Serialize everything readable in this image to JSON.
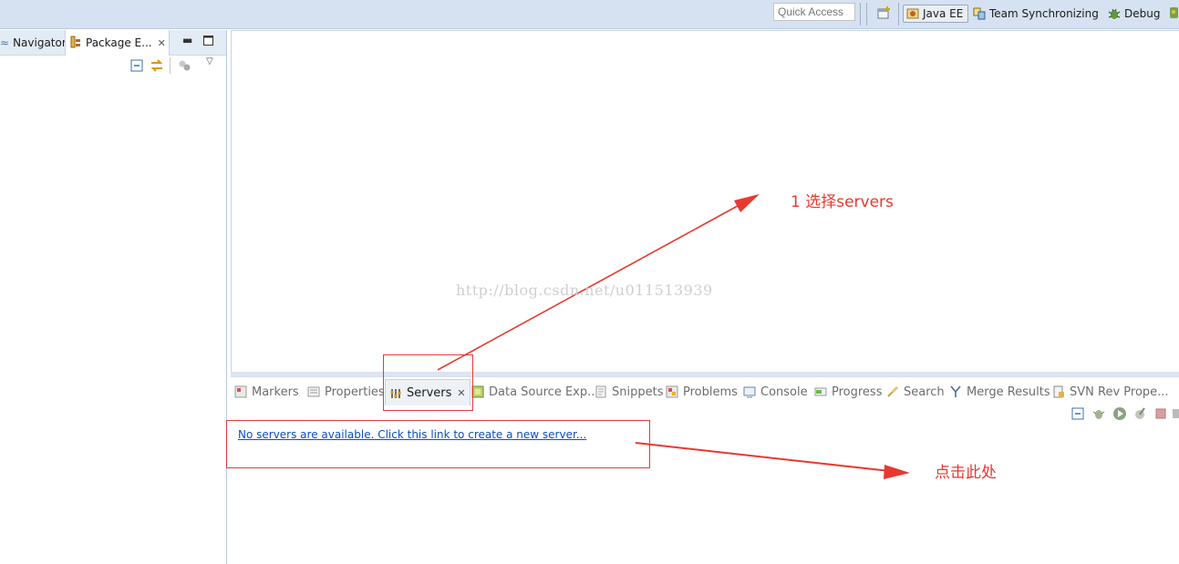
{
  "toolbar": {
    "quick_access_placeholder": "Quick Access",
    "perspectives": [
      {
        "label": "Java EE",
        "icon": "java-ee-perspective-icon",
        "active": true
      },
      {
        "label": "Team Synchronizing",
        "icon": "team-sync-icon"
      },
      {
        "label": "Debug",
        "icon": "bug-icon"
      }
    ]
  },
  "left_view": {
    "tabs": [
      {
        "label": "Navigator"
      },
      {
        "label": "Package E...",
        "active": true
      }
    ]
  },
  "bottom_panel": {
    "tabs": [
      {
        "label": "Markers",
        "icon": "markers-icon"
      },
      {
        "label": "Properties",
        "icon": "properties-icon"
      },
      {
        "label": "Servers",
        "icon": "servers-icon",
        "active": true
      },
      {
        "label": "Data Source Exp...",
        "icon": "data-source-icon"
      },
      {
        "label": "Snippets",
        "icon": "snippets-icon"
      },
      {
        "label": "Problems",
        "icon": "problems-icon"
      },
      {
        "label": "Console",
        "icon": "console-icon"
      },
      {
        "label": "Progress",
        "icon": "progress-icon"
      },
      {
        "label": "Search",
        "icon": "search-icon"
      },
      {
        "label": "Merge Results",
        "icon": "merge-icon"
      },
      {
        "label": "SVN Rev Prope...",
        "icon": "svn-icon"
      }
    ],
    "servers_link": "No servers are available. Click this link to create a new server..."
  },
  "annotations": {
    "step1": "1 选择servers",
    "step2": "点击此处",
    "watermark": "http://blog.csdn.net/u011513939",
    "color": "#e8392f"
  }
}
